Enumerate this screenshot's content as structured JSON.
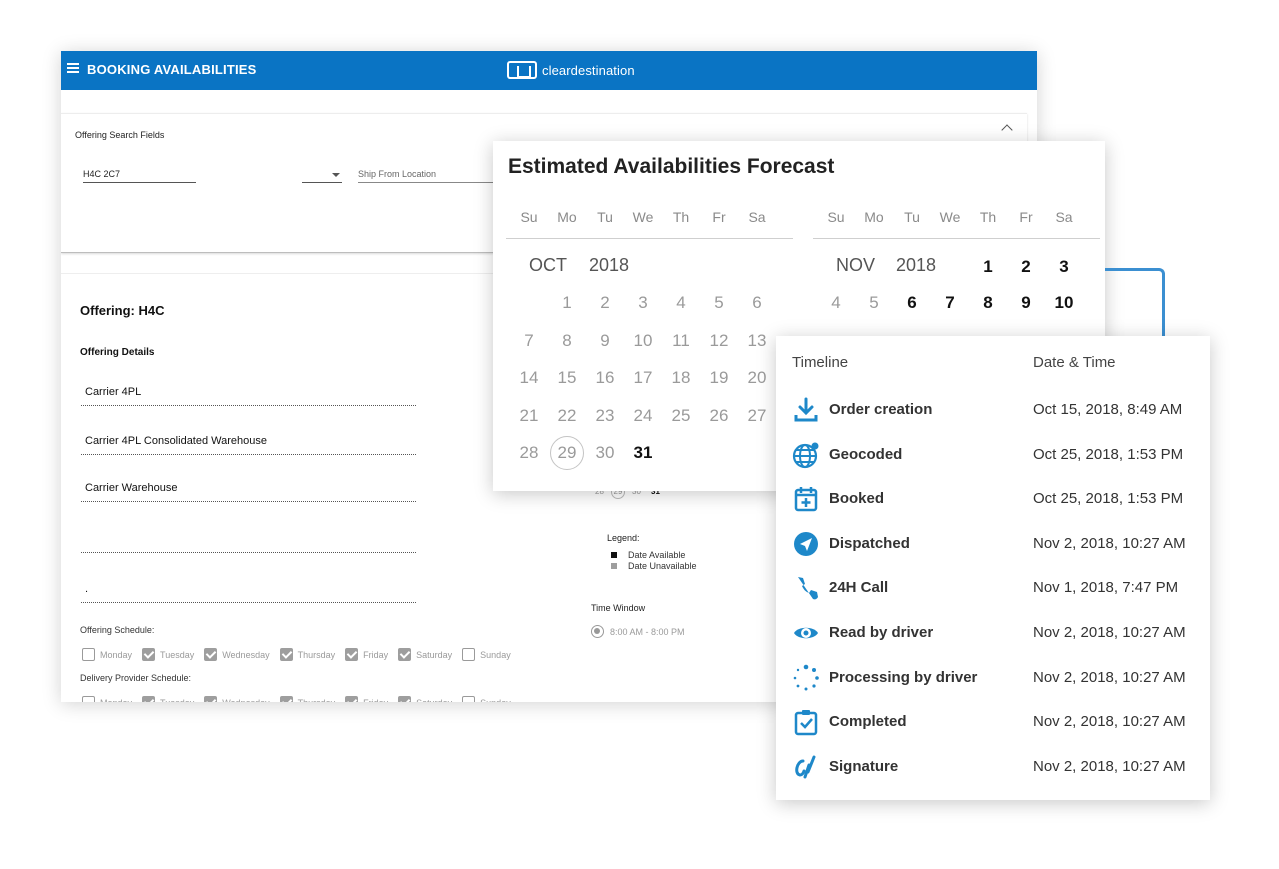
{
  "app": {
    "title": "BOOKING AVAILABILITIES",
    "brand": "cleardestination",
    "accent_color": "#0a74c4"
  },
  "search": {
    "title": "Offering Search Fields",
    "postal_value": "H4C 2C7",
    "ship_from_placeholder": "Ship From Location"
  },
  "offering": {
    "title": "Offering: H4C",
    "details_title": "Offering Details",
    "fields": [
      "Carrier 4PL",
      "Carrier 4PL Consolidated Warehouse",
      "Carrier Warehouse",
      "",
      "."
    ],
    "schedule_label": "Offering Schedule:",
    "delivery_schedule_label": "Delivery Provider Schedule:",
    "days": [
      {
        "label": "Monday",
        "checked": false
      },
      {
        "label": "Tuesday",
        "checked": true
      },
      {
        "label": "Wednesday",
        "checked": true
      },
      {
        "label": "Thursday",
        "checked": true
      },
      {
        "label": "Friday",
        "checked": true
      },
      {
        "label": "Saturday",
        "checked": true
      },
      {
        "label": "Sunday",
        "checked": false
      }
    ]
  },
  "mini_calendar_row": [
    "28",
    "29",
    "30",
    "31"
  ],
  "legend": {
    "title": "Legend:",
    "available": "Date Available",
    "unavailable": "Date Unavailable",
    "available_color": "#111111",
    "unavailable_color": "#9e9e9e"
  },
  "time_window": {
    "title": "Time Window",
    "option": "8:00 AM - 8:00 PM"
  },
  "forecast": {
    "title": "Estimated Availabilities Forecast",
    "weekdays": [
      "Su",
      "Mo",
      "Tu",
      "We",
      "Th",
      "Fr",
      "Sa"
    ],
    "october": {
      "month": "OCT",
      "year": "2018",
      "weeks": [
        [
          "",
          "1",
          "2",
          "3",
          "4",
          "5",
          "6"
        ],
        [
          "7",
          "8",
          "9",
          "10",
          "11",
          "12",
          "13"
        ],
        [
          "14",
          "15",
          "16",
          "17",
          "18",
          "19",
          "20"
        ],
        [
          "21",
          "22",
          "23",
          "24",
          "25",
          "26",
          "27"
        ],
        [
          "28",
          "29",
          "30",
          "31",
          "",
          "",
          ""
        ]
      ],
      "available": [
        "31"
      ],
      "today": "29"
    },
    "november": {
      "month": "NOV",
      "year": "2018",
      "weeks": [
        [
          "",
          "",
          "",
          "",
          "1",
          "2",
          "3"
        ],
        [
          "4",
          "5",
          "6",
          "7",
          "8",
          "9",
          "10"
        ]
      ],
      "available": [
        "1",
        "2",
        "3",
        "6",
        "7",
        "8",
        "9",
        "10"
      ]
    }
  },
  "timeline": {
    "header_event": "Timeline",
    "header_date": "Date & Time",
    "icon_color": "#1e88c9",
    "events": [
      {
        "label": "Order creation",
        "date": "Oct 15, 2018, 8:49 AM",
        "icon": "download-icon"
      },
      {
        "label": "Geocoded",
        "date": "Oct 25, 2018, 1:53 PM",
        "icon": "globe-pin-icon"
      },
      {
        "label": "Booked",
        "date": "Oct 25, 2018, 1:53 PM",
        "icon": "calendar-plus-icon"
      },
      {
        "label": "Dispatched",
        "date": "Nov 2, 2018, 10:27 AM",
        "icon": "send-icon"
      },
      {
        "label": "24H Call",
        "date": "Nov 1, 2018, 7:47 PM",
        "icon": "phone-icon"
      },
      {
        "label": "Read by driver",
        "date": "Nov 2, 2018, 10:27 AM",
        "icon": "eye-icon"
      },
      {
        "label": "Processing by driver",
        "date": "Nov 2, 2018, 10:27 AM",
        "icon": "spinner-icon"
      },
      {
        "label": "Completed",
        "date": "Nov 2, 2018, 10:27 AM",
        "icon": "clipboard-check-icon"
      },
      {
        "label": "Signature",
        "date": "Nov 2, 2018, 10:27 AM",
        "icon": "signature-icon"
      }
    ]
  }
}
